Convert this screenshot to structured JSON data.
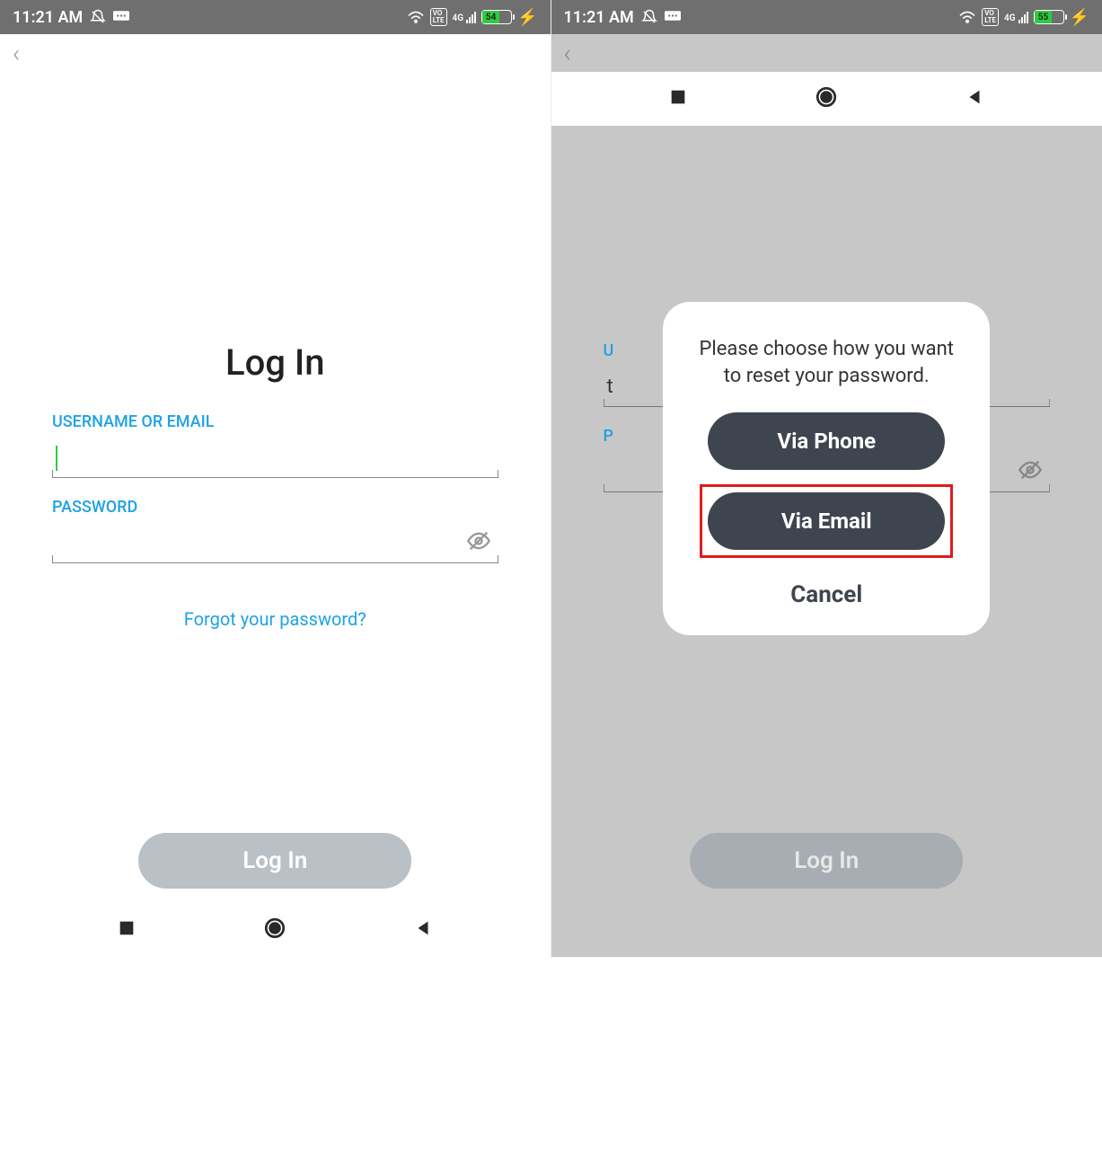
{
  "statusbar": {
    "time": "11:21 AM",
    "battery_left": "54",
    "battery_right": "55",
    "network_label": "4G"
  },
  "login": {
    "title": "Log In",
    "username_label": "USERNAME OR EMAIL",
    "password_label": "PASSWORD",
    "forgot_link": "Forgot your password?",
    "login_button": "Log In",
    "typed_value": "t"
  },
  "dialog": {
    "message": "Please choose how you want to reset your password.",
    "via_phone": "Via Phone",
    "via_email": "Via Email",
    "cancel": "Cancel"
  },
  "right_bg": {
    "username_label_partial": "U",
    "password_label_partial": "P"
  }
}
